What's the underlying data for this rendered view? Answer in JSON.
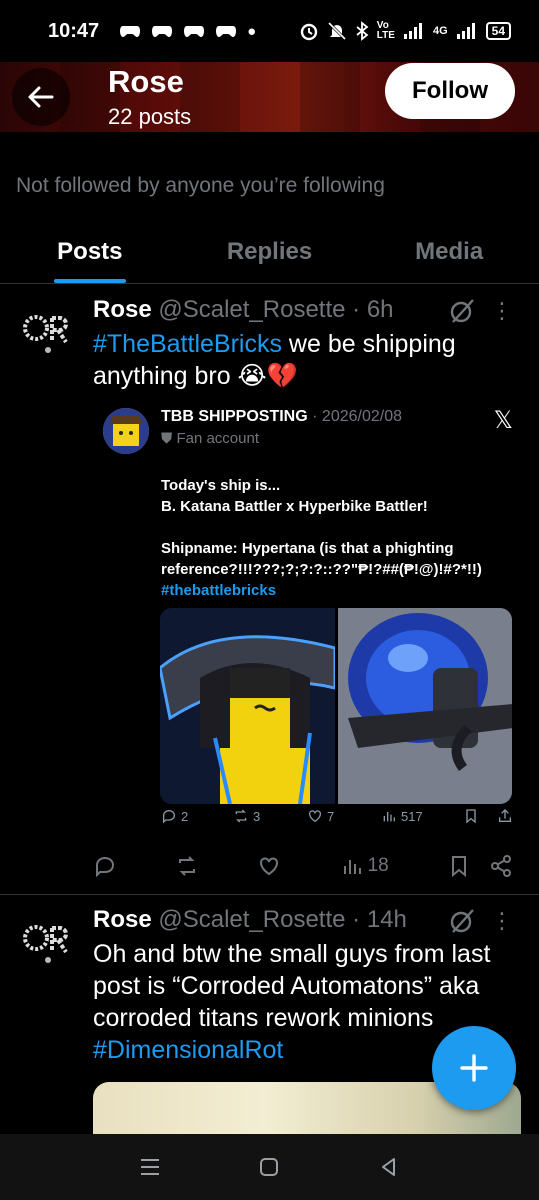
{
  "status_bar": {
    "time": "10:47",
    "battery": "54",
    "network": "4G"
  },
  "header": {
    "name": "Rose",
    "posts_count": "22 posts",
    "follow_label": "Follow"
  },
  "profile": {
    "not_followed": "Not followed by anyone you’re following"
  },
  "tabs": [
    "Posts",
    "Replies",
    "Media"
  ],
  "active_tab": "Posts",
  "posts": [
    {
      "name": "Rose",
      "handle": "@Scalet_Rosette",
      "time": "· 6h",
      "hashtag": "#TheBattleBricks",
      "text": " we be shipping anything bro 😭💔",
      "quote": {
        "name": "TBB SHIPPOSTING",
        "date": "· 2026/02/08",
        "badge": "Fan account",
        "text": "Today's ship is...\nB. Katana Battler x Hyperbike Battler!\n\nShipname: Hypertana (is that a phighting reference?!!!???;?;?:?::??\"₱!?##(₱!@)!#?*!!)",
        "hashtag": "#thebattlebricks",
        "replies": "2",
        "reposts": "3",
        "likes": "7",
        "views": "517"
      },
      "views": "18"
    },
    {
      "name": "Rose",
      "handle": "@Scalet_Rosette",
      "time": "· 14h",
      "text": "Oh and btw the small guys from last post is “Corroded Automatons” aka corroded titans rework minions",
      "hashtag": "#DimensionalRot"
    }
  ],
  "colors": {
    "accent": "#1d9bf0",
    "background": "#000000",
    "muted": "#71767b"
  }
}
